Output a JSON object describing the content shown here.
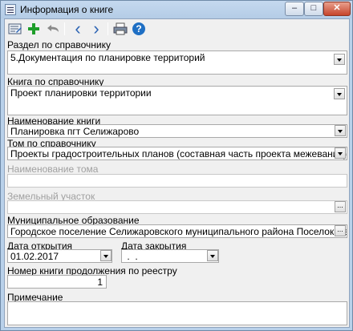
{
  "window": {
    "title": "Информация о книге",
    "minimize": "–",
    "maximize": "□",
    "close": "✕"
  },
  "toolbar": {
    "items": [
      "form-icon",
      "add-icon",
      "undo-icon",
      "back-icon",
      "forward-icon",
      "print-icon",
      "help-icon"
    ],
    "back_glyph": "‹",
    "forward_glyph": "›",
    "help_glyph": "?"
  },
  "form": {
    "section_label": "Раздел по справочнику",
    "section_value": "5.Документация по планировке территорий",
    "book_ref_label": "Книга по справочнику",
    "book_ref_value": "Проект планировки территории",
    "book_name_label": "Наименование книги",
    "book_name_value": "Планировка пгт Селижарово",
    "volume_ref_label": "Том по справочнику",
    "volume_ref_value": "Проекты градостроительных планов (составная часть проекта межевания)",
    "volume_name_label": "Наименование тома",
    "volume_name_value": "",
    "land_plot_label": "Земельный участок",
    "land_plot_value": "",
    "municipality_label": "Муниципальное образование",
    "municipality_value": "Городское поселение Селижаровского муниципального района Поселок Селижарово",
    "open_date_label": "Дата открытия",
    "open_date_value": "01.02.2017",
    "close_date_label": "Дата закрытия",
    "close_date_value": " .  .",
    "continuation_label": "Номер книги продолжения по реестру",
    "continuation_value": "1",
    "note_label": "Примечание",
    "note_value": "",
    "ellipsis": "..."
  },
  "colors": {
    "title_bar": "#b9d1ea",
    "close_button": "#c7452c",
    "add_icon": "#1e9e2a",
    "help_icon": "#1f6fc4",
    "disabled_text": "#a0a0a0"
  }
}
